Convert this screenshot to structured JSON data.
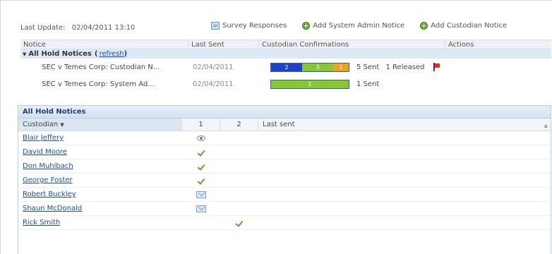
{
  "toolbar": {
    "last_update_label": "Last Update:",
    "last_update_value": "02/04/2011 13:10",
    "survey_label": "Survey Responses",
    "add_admin_label": "Add System Admin Notice",
    "add_custodian_label": "Add Custodian Notice"
  },
  "notice_grid": {
    "headers": {
      "notice": "Notice",
      "last_sent": "Last Sent",
      "confirmations": "Custodian Confirmations",
      "actions": "Actions"
    },
    "group": {
      "label": "All Hold Notices",
      "link": "refresh"
    },
    "rows": [
      {
        "notice": "SEC v Temes Corp: Custodian N...",
        "last_sent": "02/04/2011",
        "segments": [
          {
            "label": "2",
            "color": "blue",
            "fraction": 0.4
          },
          {
            "label": "3",
            "color": "green",
            "fraction": 0.4
          },
          {
            "label": "1",
            "color": "orange",
            "fraction": 0.2
          }
        ],
        "sent": "5 Sent",
        "released": "1 Released"
      },
      {
        "notice": "SEC v Temes Corp: System Ad...",
        "last_sent": "02/04/2011",
        "segments": [
          {
            "label": "1",
            "color": "green",
            "fraction": 1.0
          }
        ],
        "sent": "1 Sent",
        "released": ""
      }
    ]
  },
  "hold_panel": {
    "title": "All Hold Notices",
    "headers": {
      "custodian": "Custodian",
      "col1": "1",
      "col2": "2",
      "last_sent": "Last sent"
    },
    "custodians": [
      {
        "name": "Blair Jeffery",
        "col1": "eye",
        "col2": ""
      },
      {
        "name": "David Moore",
        "col1": "check",
        "col2": ""
      },
      {
        "name": "Don Muhlbach",
        "col1": "check",
        "col2": ""
      },
      {
        "name": "George Foster",
        "col1": "check",
        "col2": ""
      },
      {
        "name": "Robert Buckley",
        "col1": "mail",
        "col2": ""
      },
      {
        "name": "Shaun McDonald",
        "col1": "mail",
        "col2": ""
      },
      {
        "name": "Rick Smith",
        "col1": "",
        "col2": "check"
      }
    ]
  }
}
